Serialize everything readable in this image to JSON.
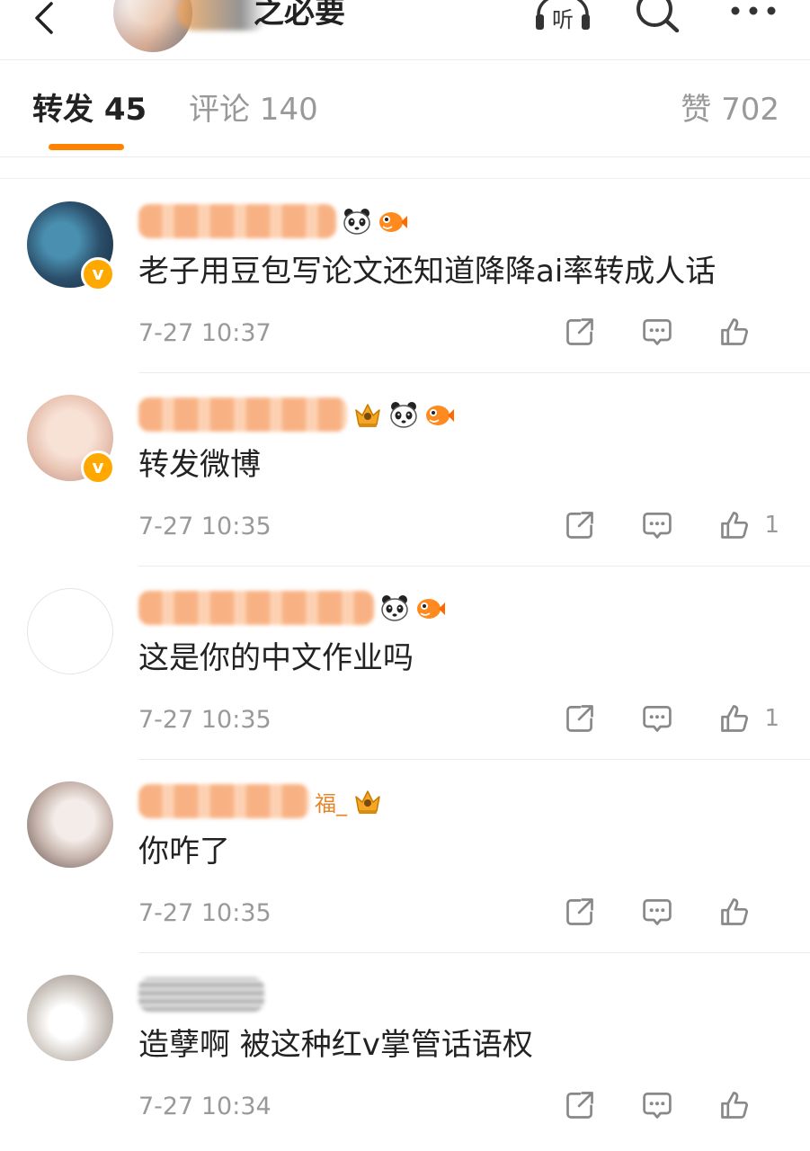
{
  "colors": {
    "accent": "#ff8200",
    "text": "#222222",
    "muted": "#999999",
    "verified": "#ffa800"
  },
  "header": {
    "title_visible": "之必要",
    "icons": [
      "back-icon",
      "listen-icon",
      "search-icon",
      "more-icon"
    ],
    "listen_label": "听"
  },
  "tabs": [
    {
      "label": "转发 45",
      "active": true
    },
    {
      "label": "评论 140",
      "active": false
    },
    {
      "label": "赞 702",
      "active": false
    }
  ],
  "comments": [
    {
      "name_visible": "",
      "content": "老子用豆包写论文还知道降降ai率转成人话",
      "time": "7-27 10:37",
      "likes": "",
      "verified": true,
      "badges": [
        "panda-icon",
        "fish-icon"
      ]
    },
    {
      "name_visible": "",
      "content": "转发微博",
      "time": "7-27 10:35",
      "likes": "1",
      "verified": true,
      "badges": [
        "crown-badge-icon",
        "panda-icon",
        "fish-icon"
      ]
    },
    {
      "name_visible": "",
      "content": "这是你的中文作业吗",
      "time": "7-27 10:35",
      "likes": "1",
      "verified": false,
      "badges": [
        "panda-icon",
        "fish-icon"
      ]
    },
    {
      "name_visible": "福_",
      "content": "你咋了",
      "time": "7-27 10:35",
      "likes": "",
      "verified": false,
      "badges": [
        "crown-badge-icon"
      ]
    },
    {
      "name_visible": "",
      "content": "造孽啊 被这种红v掌管话语权",
      "time": "7-27 10:34",
      "likes": "",
      "verified": false,
      "badges": []
    }
  ]
}
